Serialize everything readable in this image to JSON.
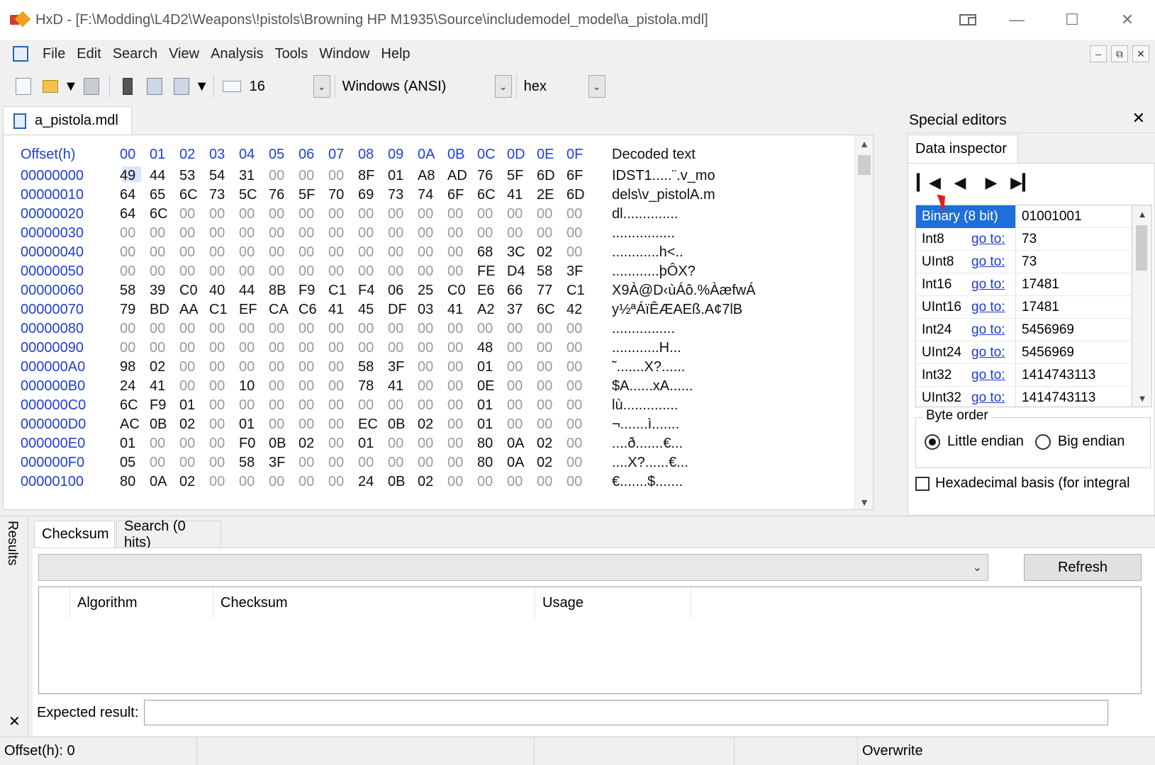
{
  "window": {
    "title": "HxD - [F:\\Modding\\L4D2\\Weapons\\!pistols\\Browning HP M1935\\Source\\includemodel_model\\a_pistola.mdl]"
  },
  "menu": [
    "File",
    "Edit",
    "Search",
    "View",
    "Analysis",
    "Tools",
    "Window",
    "Help"
  ],
  "toolbar": {
    "bytes_per_row": "16",
    "encoding": "Windows (ANSI)",
    "offset_base": "hex"
  },
  "document_tab": {
    "label": "a_pistola.mdl"
  },
  "hex": {
    "header_offset": "Offset(h)",
    "header_columns": [
      "00",
      "01",
      "02",
      "03",
      "04",
      "05",
      "06",
      "07",
      "08",
      "09",
      "0A",
      "0B",
      "0C",
      "0D",
      "0E",
      "0F"
    ],
    "header_text": "Decoded text",
    "rows": [
      {
        "offset": "00000000",
        "bytes": [
          "49",
          "44",
          "53",
          "54",
          "31",
          "00",
          "00",
          "00",
          "8F",
          "01",
          "A8",
          "AD",
          "76",
          "5F",
          "6D",
          "6F"
        ],
        "text": "IDST1.....¨.v_mo"
      },
      {
        "offset": "00000010",
        "bytes": [
          "64",
          "65",
          "6C",
          "73",
          "5C",
          "76",
          "5F",
          "70",
          "69",
          "73",
          "74",
          "6F",
          "6C",
          "41",
          "2E",
          "6D"
        ],
        "text": "dels\\v_pistolA.m"
      },
      {
        "offset": "00000020",
        "bytes": [
          "64",
          "6C",
          "00",
          "00",
          "00",
          "00",
          "00",
          "00",
          "00",
          "00",
          "00",
          "00",
          "00",
          "00",
          "00",
          "00"
        ],
        "text": "dl.............."
      },
      {
        "offset": "00000030",
        "bytes": [
          "00",
          "00",
          "00",
          "00",
          "00",
          "00",
          "00",
          "00",
          "00",
          "00",
          "00",
          "00",
          "00",
          "00",
          "00",
          "00"
        ],
        "text": "................"
      },
      {
        "offset": "00000040",
        "bytes": [
          "00",
          "00",
          "00",
          "00",
          "00",
          "00",
          "00",
          "00",
          "00",
          "00",
          "00",
          "00",
          "68",
          "3C",
          "02",
          "00"
        ],
        "text": "............h<.."
      },
      {
        "offset": "00000050",
        "bytes": [
          "00",
          "00",
          "00",
          "00",
          "00",
          "00",
          "00",
          "00",
          "00",
          "00",
          "00",
          "00",
          "FE",
          "D4",
          "58",
          "3F"
        ],
        "text": "............þÔX?"
      },
      {
        "offset": "00000060",
        "bytes": [
          "58",
          "39",
          "C0",
          "40",
          "44",
          "8B",
          "F9",
          "C1",
          "F4",
          "06",
          "25",
          "C0",
          "E6",
          "66",
          "77",
          "C1"
        ],
        "text": "X9À@D‹ùÁô.%ÀæfwÁ"
      },
      {
        "offset": "00000070",
        "bytes": [
          "79",
          "BD",
          "AA",
          "C1",
          "EF",
          "CA",
          "C6",
          "41",
          "45",
          "DF",
          "03",
          "41",
          "A2",
          "37",
          "6C",
          "42"
        ],
        "text": "y½ªÁïÊÆAEß.A¢7lB"
      },
      {
        "offset": "00000080",
        "bytes": [
          "00",
          "00",
          "00",
          "00",
          "00",
          "00",
          "00",
          "00",
          "00",
          "00",
          "00",
          "00",
          "00",
          "00",
          "00",
          "00"
        ],
        "text": "................"
      },
      {
        "offset": "00000090",
        "bytes": [
          "00",
          "00",
          "00",
          "00",
          "00",
          "00",
          "00",
          "00",
          "00",
          "00",
          "00",
          "00",
          "48",
          "00",
          "00",
          "00"
        ],
        "text": "............H..."
      },
      {
        "offset": "000000A0",
        "bytes": [
          "98",
          "02",
          "00",
          "00",
          "00",
          "00",
          "00",
          "00",
          "58",
          "3F",
          "00",
          "00",
          "01",
          "00",
          "00",
          "00"
        ],
        "text": "˜.......X?......"
      },
      {
        "offset": "000000B0",
        "bytes": [
          "24",
          "41",
          "00",
          "00",
          "10",
          "00",
          "00",
          "00",
          "78",
          "41",
          "00",
          "00",
          "0E",
          "00",
          "00",
          "00"
        ],
        "text": "$A......xA......"
      },
      {
        "offset": "000000C0",
        "bytes": [
          "6C",
          "F9",
          "01",
          "00",
          "00",
          "00",
          "00",
          "00",
          "00",
          "00",
          "00",
          "00",
          "01",
          "00",
          "00",
          "00"
        ],
        "text": "lù.............."
      },
      {
        "offset": "000000D0",
        "bytes": [
          "AC",
          "0B",
          "02",
          "00",
          "01",
          "00",
          "00",
          "00",
          "EC",
          "0B",
          "02",
          "00",
          "01",
          "00",
          "00",
          "00"
        ],
        "text": "¬.......ì......."
      },
      {
        "offset": "000000E0",
        "bytes": [
          "01",
          "00",
          "00",
          "00",
          "F0",
          "0B",
          "02",
          "00",
          "01",
          "00",
          "00",
          "00",
          "80",
          "0A",
          "02",
          "00"
        ],
        "text": "....ð.......€..."
      },
      {
        "offset": "000000F0",
        "bytes": [
          "05",
          "00",
          "00",
          "00",
          "58",
          "3F",
          "00",
          "00",
          "00",
          "00",
          "00",
          "00",
          "80",
          "0A",
          "02",
          "00"
        ],
        "text": "....X?......€..."
      },
      {
        "offset": "00000100",
        "bytes": [
          "80",
          "0A",
          "02",
          "00",
          "00",
          "00",
          "00",
          "00",
          "24",
          "0B",
          "02",
          "00",
          "00",
          "00",
          "00",
          "00"
        ],
        "text": "€.......$......."
      }
    ]
  },
  "special_editors": {
    "title": "Special editors",
    "tab": "Data inspector",
    "goto_label": "go to:",
    "rows": [
      {
        "name": "Binary (8 bit)",
        "value": "01001001",
        "selected": true
      },
      {
        "name": "Int8",
        "value": "73"
      },
      {
        "name": "UInt8",
        "value": "73"
      },
      {
        "name": "Int16",
        "value": "17481"
      },
      {
        "name": "UInt16",
        "value": "17481"
      },
      {
        "name": "Int24",
        "value": "5456969"
      },
      {
        "name": "UInt24",
        "value": "5456969"
      },
      {
        "name": "Int32",
        "value": "1414743113"
      },
      {
        "name": "UInt32",
        "value": "1414743113"
      }
    ],
    "byte_order": {
      "label": "Byte order",
      "little": "Little endian",
      "big": "Big endian",
      "selected": "little"
    },
    "hex_basis": "Hexadecimal basis (for integral"
  },
  "results": {
    "side_label": "Results",
    "tabs": [
      "Checksum",
      "Search (0 hits)"
    ],
    "refresh": "Refresh",
    "columns": [
      "Algorithm",
      "Checksum",
      "Usage"
    ],
    "expected_label": "Expected result:"
  },
  "status": {
    "offset": "Offset(h): 0",
    "mode": "Overwrite"
  }
}
